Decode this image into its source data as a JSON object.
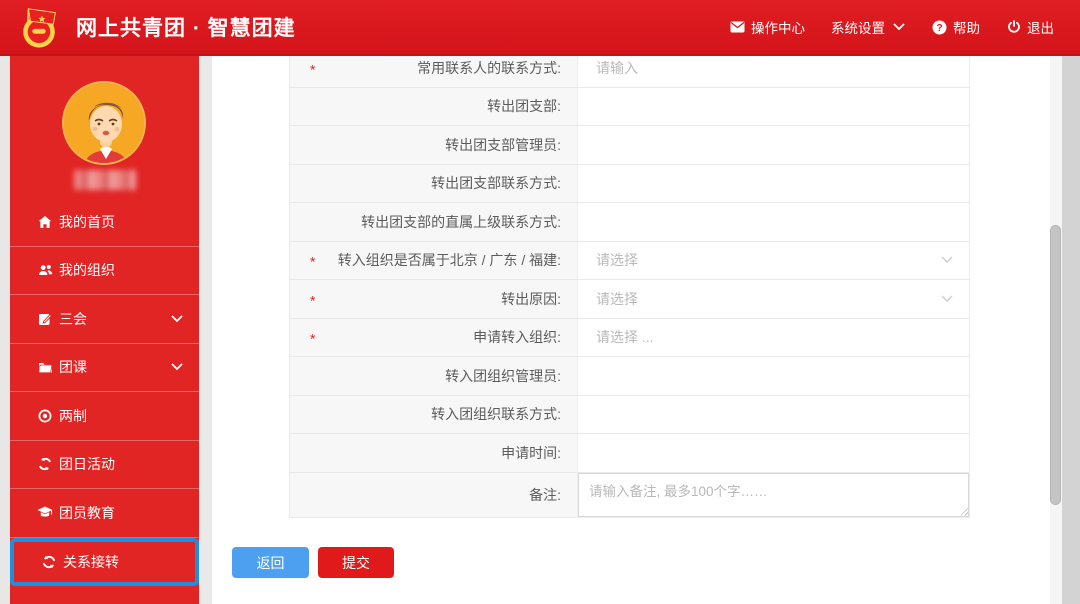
{
  "header": {
    "title": "网上共青团 · 智慧团建",
    "nav": {
      "operation_center": "操作中心",
      "system_settings": "系统设置",
      "help": "帮助",
      "logout": "退出"
    }
  },
  "sidebar": {
    "items": [
      {
        "label": "我的首页",
        "icon": "home-icon",
        "expandable": false,
        "active": false
      },
      {
        "label": "我的组织",
        "icon": "users-icon",
        "expandable": false,
        "active": false
      },
      {
        "label": "三会",
        "icon": "edit-icon",
        "expandable": true,
        "active": false
      },
      {
        "label": "团课",
        "icon": "folder-icon",
        "expandable": true,
        "active": false
      },
      {
        "label": "两制",
        "icon": "target-icon",
        "expandable": false,
        "active": false
      },
      {
        "label": "团日活动",
        "icon": "recycle-icon",
        "expandable": false,
        "active": false
      },
      {
        "label": "团员教育",
        "icon": "graduation-cap-icon",
        "expandable": false,
        "active": false
      },
      {
        "label": "关系接转",
        "icon": "sync-icon",
        "expandable": false,
        "active": true
      }
    ]
  },
  "form": {
    "required_marker": "*",
    "rows": [
      {
        "required": true,
        "label": "常用联系人的联系方式:",
        "control": "input",
        "placeholder": "请输入",
        "value": ""
      },
      {
        "required": false,
        "label": "转出团支部:",
        "control": "text",
        "value": ""
      },
      {
        "required": false,
        "label": "转出团支部管理员:",
        "control": "text",
        "value": ""
      },
      {
        "required": false,
        "label": "转出团支部联系方式:",
        "control": "text",
        "value": ""
      },
      {
        "required": false,
        "label": "转出团支部的直属上级联系方式:",
        "control": "text",
        "value": ""
      },
      {
        "required": true,
        "label": "转入组织是否属于北京 / 广东 / 福建:",
        "control": "select",
        "placeholder": "请选择",
        "value": ""
      },
      {
        "required": true,
        "label": "转出原因:",
        "control": "select",
        "placeholder": "请选择",
        "value": ""
      },
      {
        "required": true,
        "label": "申请转入组织:",
        "control": "picker",
        "placeholder": "请选择 ...",
        "value": ""
      },
      {
        "required": false,
        "label": "转入团组织管理员:",
        "control": "text",
        "value": ""
      },
      {
        "required": false,
        "label": "转入团组织联系方式:",
        "control": "text",
        "value": ""
      },
      {
        "required": false,
        "label": "申请时间:",
        "control": "text",
        "value": ""
      },
      {
        "required": false,
        "label": "备注:",
        "control": "textarea",
        "placeholder": "请输入备注, 最多100个字……",
        "value": ""
      }
    ]
  },
  "actions": {
    "back_label": "返回",
    "submit_label": "提交"
  },
  "colors": {
    "header_red": "#d91a20",
    "sidebar_red": "#e12424",
    "active_border_blue": "#1d8fe1",
    "back_button_blue": "#4d9ff0",
    "submit_button_red": "#e01a1a",
    "required_red": "#e02020",
    "label_column_bg": "#f7f7f7"
  }
}
